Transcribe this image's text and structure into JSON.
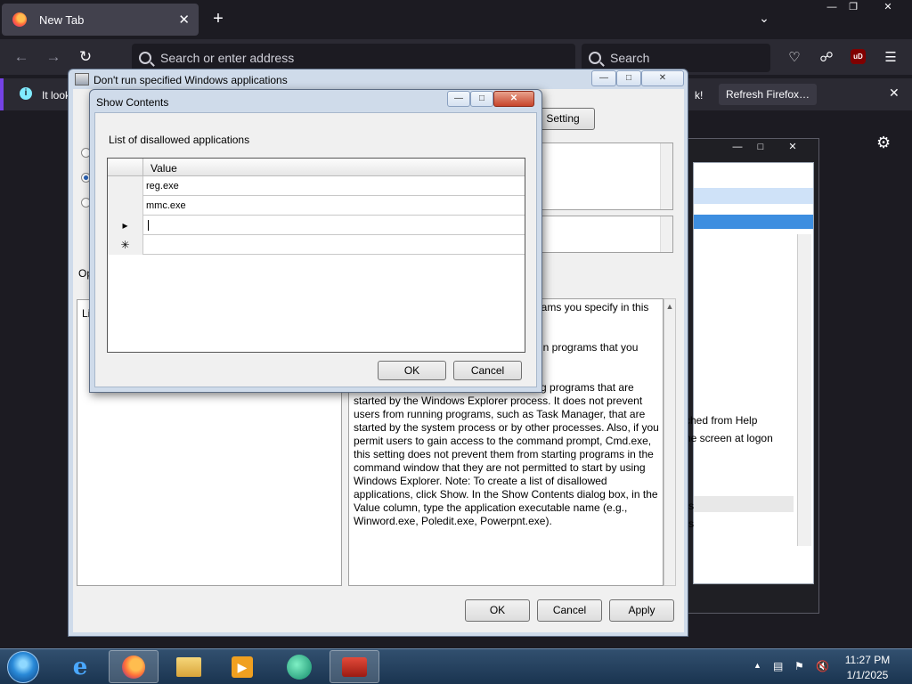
{
  "browser": {
    "tab_title": "New Tab",
    "tab_close": "✕",
    "new_tab": "+",
    "tab_list": "⌄",
    "url_placeholder": "Search or enter address",
    "search_placeholder": "Search",
    "ublock_label": "uD",
    "notification_text": "It look",
    "notification_tail": "k!",
    "refresh_label": "Refresh Firefox…",
    "notification_close": "✕"
  },
  "policy_window": {
    "title": "Don't run specified Windows applications",
    "next_setting": "Setting",
    "options_label": "Op",
    "options_text": "Li",
    "help_lines": [
      "grams you specify in this",
      "in programs that you",
      "ning programs that are",
      "started by the Windows Explorer process. It does not prevent",
      "users from running programs, such as Task Manager, that are",
      "started by the system process or by other processes. Also, if you",
      "permit users to gain access to the command prompt, Cmd.exe,",
      "this setting does not prevent them from starting programs in the",
      "command window that they are not permitted to start by using",
      "Windows Explorer. Note: To create a list of disallowed",
      "applications, click Show. In the Show Contents dialog box, in the",
      "Value column, type the application executable name (e.g.,",
      "Winword.exe, Poledit.exe, Powerpnt.exe)."
    ],
    "ok": "OK",
    "cancel": "Cancel",
    "apply": "Apply"
  },
  "gpedit_window": {
    "fragments": [
      "ched from Help",
      "ne screen at logon",
      "s",
      "s"
    ]
  },
  "show_contents": {
    "title": "Show Contents",
    "list_label": "List of disallowed applications",
    "column_header": "Value",
    "rows": [
      {
        "marker": "",
        "value": "reg.exe"
      },
      {
        "marker": "",
        "value": "mmc.exe"
      },
      {
        "marker": "▸",
        "value": ""
      },
      {
        "marker": "✳",
        "value": ""
      }
    ],
    "ok": "OK",
    "cancel": "Cancel"
  },
  "taskbar": {
    "time": "11:27 PM",
    "date": "1/1/2025"
  }
}
